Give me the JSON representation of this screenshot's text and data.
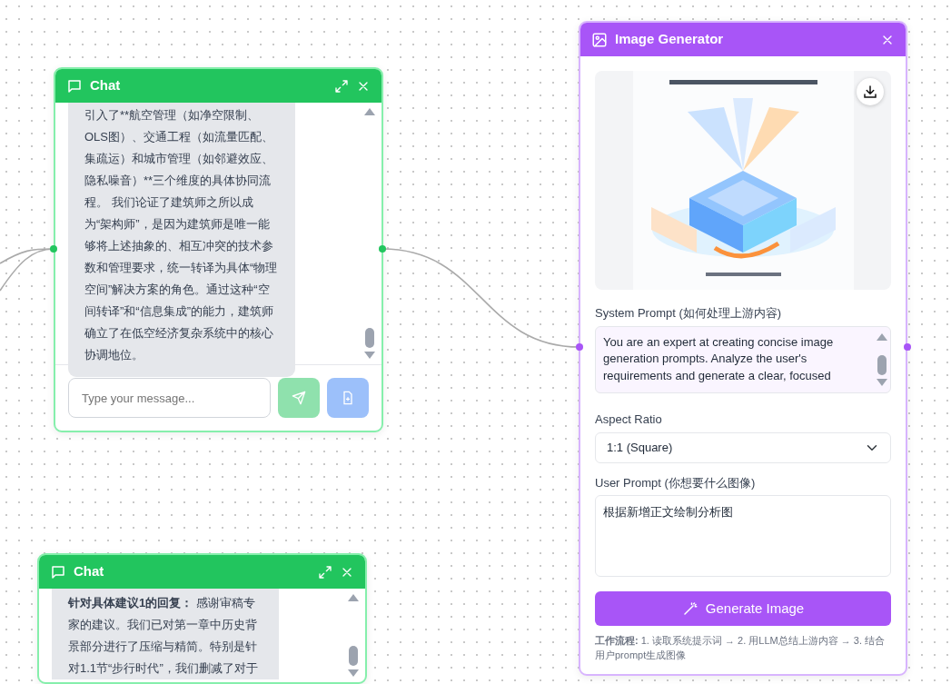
{
  "nodes": [
    {
      "kind": "chat",
      "title": "Chat",
      "message": "引入了**航空管理（如净空限制、OLS图）、交通工程（如流量匹配、集疏运）和城市管理（如邻避效应、隐私噪音）**三个维度的具体协同流程。 我们论证了建筑师之所以成为“架构师”，是因为建筑师是唯一能够将上述抽象的、相互冲突的技术参数和管理要求，统一转译为具体“物理空间”解决方案的角色。通过这种“空间转译”和“信息集成”的能力，建筑师确立了在低空经济复杂系统中的核心协调地位。",
      "placeholder": "Type your message...",
      "send_disabled": true,
      "upload_disabled": true
    },
    {
      "kind": "chat",
      "title": "Chat",
      "lead": "针对具体建议1的回复：",
      "message": " 感谢审稿专家的建议。我们已对第一章中历史背景部分进行了压缩与精简。特别是针对1.1节“步行时代”，我们删减了对于"
    },
    {
      "kind": "image_generator",
      "title": "Image Generator",
      "system_prompt_label": "System Prompt (如何处理上游内容)",
      "system_prompt": "You are an expert at creating concise image generation prompts. Analyze the user's requirements and generate a clear, focused",
      "aspect_label": "Aspect Ratio",
      "aspect_value": "1:1 (Square)",
      "user_prompt_label": "User Prompt (你想要什么图像)",
      "user_prompt": "根据新增正文绘制分析图",
      "button": "Generate Image",
      "workflow": "**工作流程:** 1. 读取系统提示词 → 2. 用LLM总结上游内容 → 3. 结合用户prompt生成图像"
    }
  ]
}
